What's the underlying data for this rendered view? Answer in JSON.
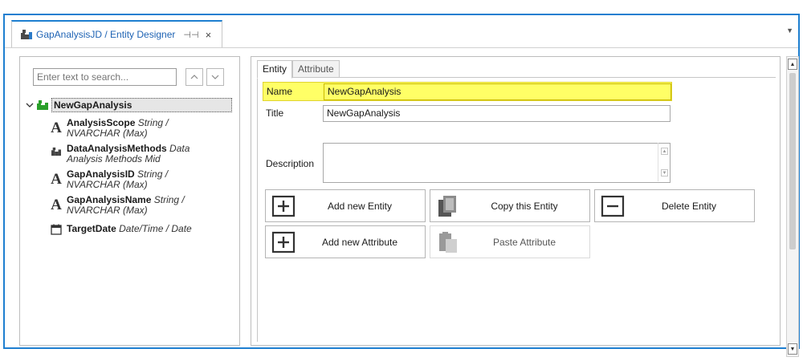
{
  "window": {
    "doc_tab_title": "GapAnalysisJD / Entity Designer",
    "pin_glyph": "⊣⊣",
    "close_glyph": "×",
    "tab_dropdown_glyph": "▼"
  },
  "left_panel": {
    "search_placeholder": "Enter text to search...",
    "root": {
      "label": "NewGapAnalysis",
      "icon": "entity-puzzle-icon"
    },
    "attributes": [
      {
        "name": "AnalysisScope",
        "type_line1": "String /",
        "type_line2": "NVARCHAR (Max)",
        "icon": "text-attribute-icon"
      },
      {
        "name": "DataAnalysisMethods",
        "type_line1": "Data",
        "type_line2": "Analysis Methods Mid",
        "icon": "puzzle-icon"
      },
      {
        "name": "GapAnalysisID",
        "type_line1": "String /",
        "type_line2": "NVARCHAR (Max)",
        "icon": "text-attribute-icon"
      },
      {
        "name": "GapAnalysisName",
        "type_line1": "String /",
        "type_line2": "NVARCHAR (Max)",
        "icon": "text-attribute-icon"
      },
      {
        "name": "TargetDate",
        "type_line1": "Date/Time / Date",
        "type_line2": "",
        "icon": "calendar-icon"
      }
    ]
  },
  "right_panel": {
    "tabs": [
      {
        "label": "Entity",
        "active": true
      },
      {
        "label": "Attribute",
        "active": false
      }
    ],
    "fields": {
      "name_label": "Name",
      "name_value": "NewGapAnalysis",
      "title_label": "Title",
      "title_value": "NewGapAnalysis",
      "description_label": "Description",
      "description_value": ""
    },
    "buttons": {
      "add_entity": "Add new Entity",
      "copy_entity": "Copy this Entity",
      "delete_entity": "Delete Entity",
      "add_attribute": "Add new Attribute",
      "paste_attribute": "Paste Attribute"
    }
  },
  "colors": {
    "frame_border": "#1e7fd0",
    "highlight": "#ffff66",
    "entity_green": "#2aa02a"
  }
}
